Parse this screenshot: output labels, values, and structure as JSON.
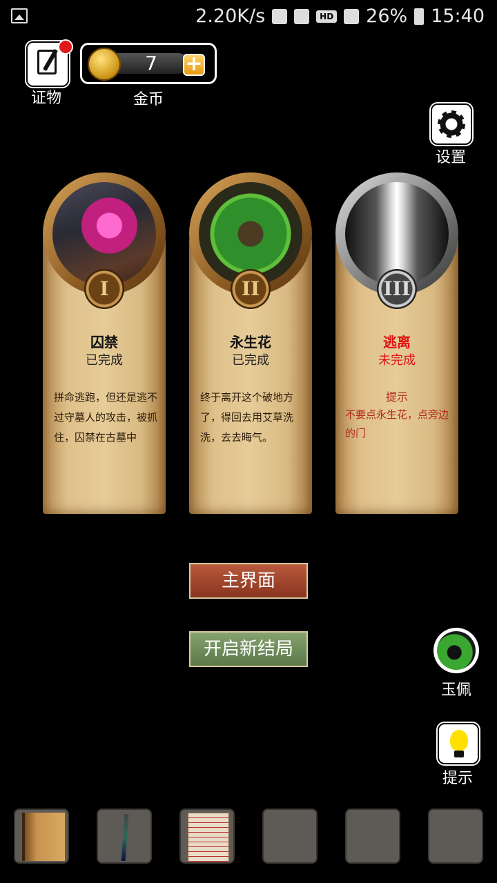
{
  "status_bar": {
    "speed": "2.20K/s",
    "battery": "26%",
    "time": "15:40",
    "hd": "HD",
    "icons": [
      "gallery-icon",
      "nfc-icon",
      "mute-icon",
      "hd-icon",
      "wifi-icon",
      "signal-icon",
      "battery-icon"
    ]
  },
  "top": {
    "evidence_label": "证物",
    "coins_label": "金币",
    "coin_count": "7",
    "plus": "+",
    "settings_label": "设置"
  },
  "cards": [
    {
      "numeral": "I",
      "title": "囚禁",
      "status": "已完成",
      "desc": "拼命逃跑，但还是逃不过守墓人的攻击，被抓住，囚禁在古墓中"
    },
    {
      "numeral": "II",
      "title": "永生花",
      "status": "已完成",
      "desc": "终于离开这个破地方了，得回去用艾草洗洗，去去晦气。"
    },
    {
      "numeral": "III",
      "title": "逃离",
      "status": "未完成",
      "hint_label": "提示",
      "hint": "不要点永生花，点旁边的门"
    }
  ],
  "buttons": {
    "main_menu": "主界面",
    "new_ending": "开启新结局"
  },
  "side": {
    "jade_label": "玉佩",
    "hint_label": "提示"
  },
  "inventory": [
    "book-item",
    "sword-item",
    "document-item",
    "empty",
    "empty",
    "empty"
  ],
  "colors": {
    "background": "#000000",
    "incomplete": "#e01414",
    "main_button": "#9a4028",
    "new_ending_button": "#6e8c5a"
  }
}
